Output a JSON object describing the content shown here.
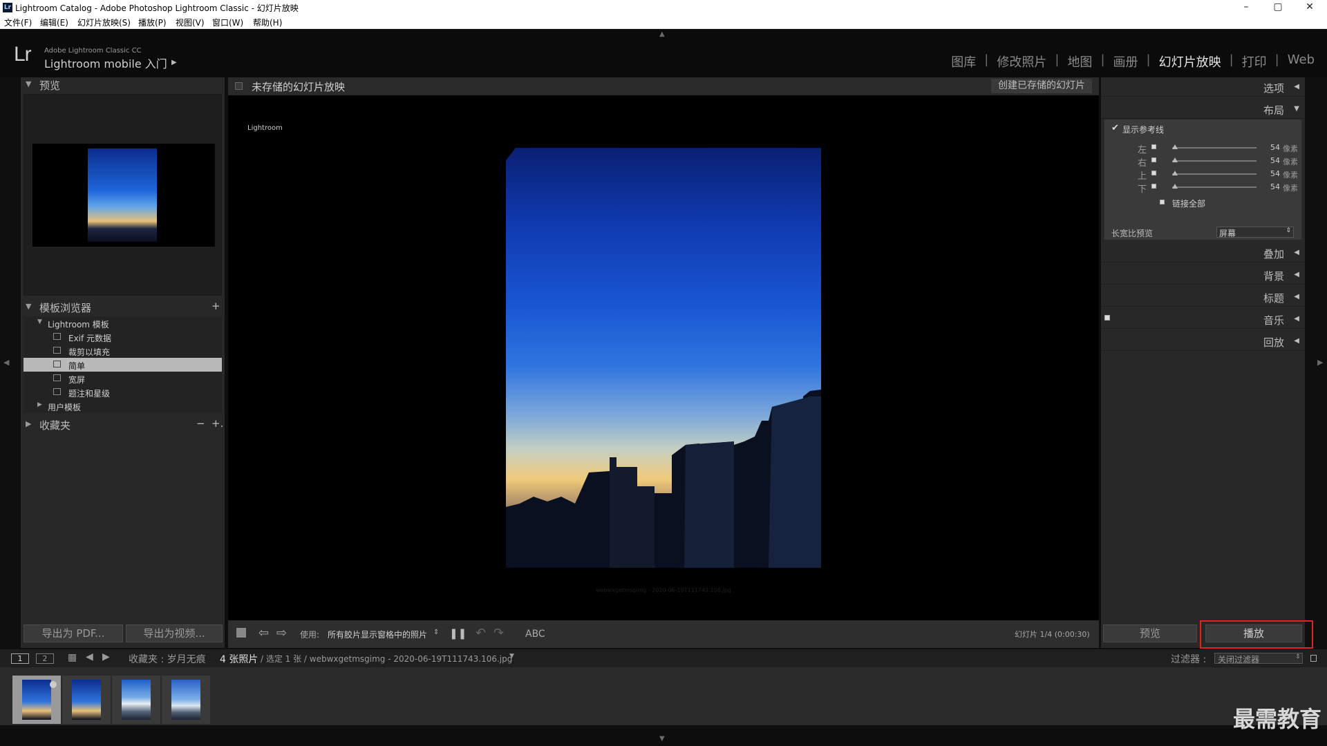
{
  "window": {
    "title": "Lightroom Catalog - Adobe Photoshop Lightroom Classic - 幻灯片放映",
    "minimize": "–",
    "maximize": "▢",
    "close": "✕"
  },
  "menu": [
    "文件(F)",
    "编辑(E)",
    "幻灯片放映(S)",
    "播放(P)",
    "视图(V)",
    "窗口(W)",
    "帮助(H)"
  ],
  "identity": {
    "logo": "Lr",
    "small": "Adobe Lightroom Classic CC",
    "big": "Lightroom mobile 入门",
    "arrow": "▶"
  },
  "modules": [
    {
      "label": "图库",
      "active": false
    },
    {
      "label": "修改照片",
      "active": false
    },
    {
      "label": "地图",
      "active": false
    },
    {
      "label": "画册",
      "active": false
    },
    {
      "label": "幻灯片放映",
      "active": true
    },
    {
      "label": "打印",
      "active": false
    },
    {
      "label": "Web",
      "active": false
    }
  ],
  "left": {
    "preview_header": "预览",
    "template_header": "模板浏览器",
    "template_add": "+",
    "tree": [
      {
        "label": "Lightroom 模板",
        "type": "folder",
        "selected": false
      },
      {
        "label": "Exif 元数据",
        "type": "item",
        "selected": false
      },
      {
        "label": "裁剪以填充",
        "type": "item",
        "selected": false
      },
      {
        "label": "简单",
        "type": "item",
        "selected": true
      },
      {
        "label": "宽屏",
        "type": "item",
        "selected": false
      },
      {
        "label": "题注和星级",
        "type": "item",
        "selected": false
      },
      {
        "label": "用户模板",
        "type": "folder-collapsed",
        "selected": false
      }
    ],
    "collections_header": "收藏夹",
    "collections_minus": "−",
    "collections_plus": "+.",
    "export_pdf": "导出为 PDF...",
    "export_video": "导出为视频..."
  },
  "center": {
    "title": "未存储的幻灯片放映",
    "create_button": "创建已存储的幻灯片",
    "identity_label": "Lightroom",
    "caption": "webwxgetmsgimg - 2020-06-19T111743.106.jpg"
  },
  "toolbar": {
    "use_label": "使用:",
    "use_value": "所有胶片显示窗格中的照片",
    "abc": "ABC",
    "slide_info": "幻灯片 1/4 (0:00:30)"
  },
  "right": {
    "options": "选项",
    "layout": "布局",
    "show_guides": "显示参考线",
    "guides": [
      {
        "side": "左",
        "value": "54",
        "unit": "像素"
      },
      {
        "side": "右",
        "value": "54",
        "unit": "像素"
      },
      {
        "side": "上",
        "value": "54",
        "unit": "像素"
      },
      {
        "side": "下",
        "value": "54",
        "unit": "像素"
      }
    ],
    "link_all": "链接全部",
    "aspect_label": "长宽比预览",
    "aspect_value": "屏幕",
    "overlay": "叠加",
    "backdrop": "背景",
    "titles": "标题",
    "music": "音乐",
    "playback": "回放",
    "preview_button": "预览",
    "play_button": "播放"
  },
  "filmbar": {
    "page1": "1",
    "page2": "2",
    "source": "收藏夹 : 岁月无痕",
    "count": "4 张照片",
    "selection": "/ 选定 1 张 / webwxgetmsgimg - 2020-06-19T111743.106.jpg",
    "filter_label": "过滤器 :",
    "filter_value": "关闭过滤器"
  },
  "watermark": "最需教育",
  "colors": {
    "accent_red": "#e02424",
    "panel": "#282828",
    "stage": "#000000"
  }
}
